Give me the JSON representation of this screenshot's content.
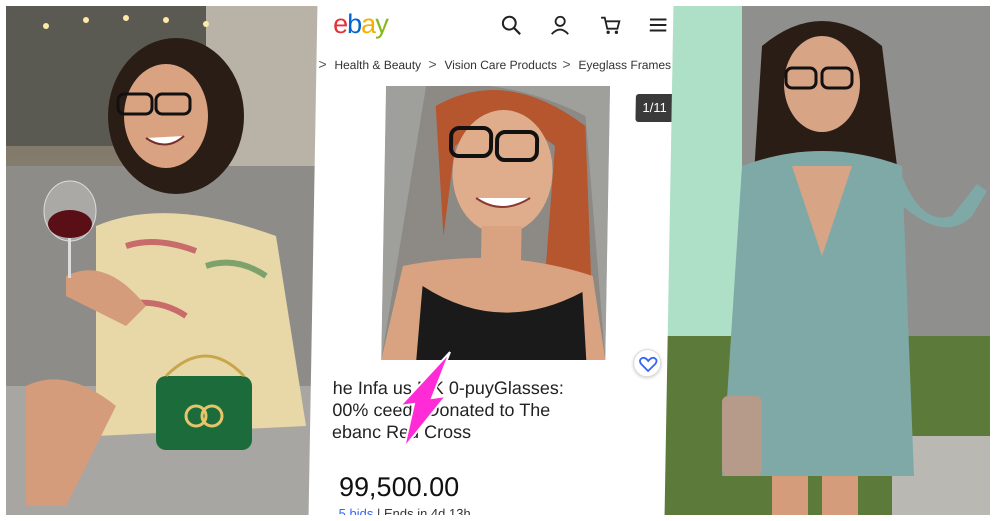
{
  "ebay": {
    "logo_letters": [
      "e",
      "b",
      "a",
      "y"
    ],
    "logo_colors": [
      "#e53238",
      "#0064d2",
      "#f5af02",
      "#86b817"
    ],
    "icons": [
      "search-icon",
      "user-icon",
      "cart-icon",
      "menu-icon"
    ]
  },
  "breadcrumb": {
    "items": [
      "Health & Beauty",
      "Vision Care Products",
      "Eyeglass Frames"
    ],
    "separator": ">"
  },
  "listing": {
    "image_counter": "1/11",
    "title_lines": [
      "he Infa    us MK 0-puyGlasses:",
      "00%    ceeds Donated to The",
      "ebanc    Red Cross"
    ],
    "price": "99,500.00",
    "bids_link": "5 bids",
    "ends_text": "| Ends in 4d 13h"
  },
  "colors": {
    "arrow": "#ff2bd6",
    "link": "#3665f3"
  }
}
